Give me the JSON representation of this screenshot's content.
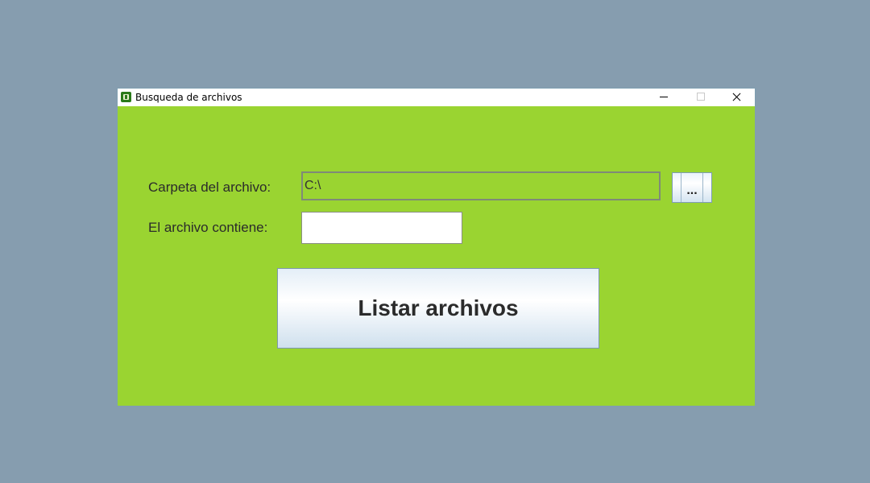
{
  "window": {
    "title": "Busqueda de archivos",
    "icon": "app-logo-icon",
    "controls": {
      "minimize": "minimize-icon",
      "maximize": "maximize-icon",
      "close": "close-icon"
    }
  },
  "form": {
    "folder_label": "Carpeta del archivo:",
    "folder_value": "C:\\",
    "browse_label": "...",
    "contains_label": "El archivo contiene:",
    "contains_value": ""
  },
  "actions": {
    "list_button_label": "Listar archivos"
  },
  "colors": {
    "desktop": "#869daf",
    "window_background": "#9ad431",
    "titlebar": "#ffffff"
  }
}
